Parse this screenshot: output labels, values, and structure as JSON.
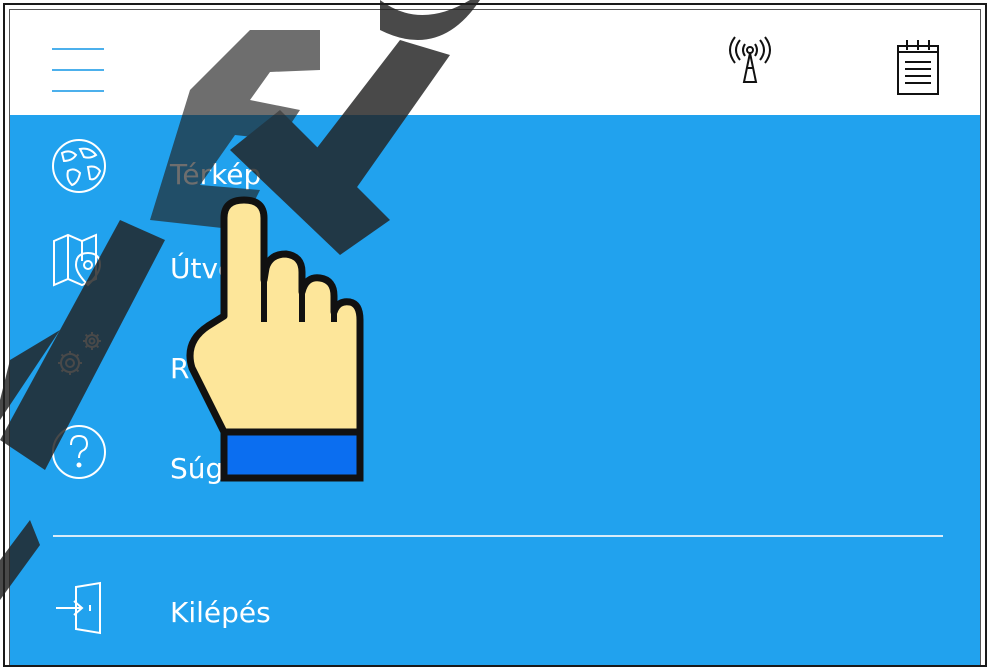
{
  "menu": {
    "items": [
      {
        "label": "Térkép",
        "icon": "globe-icon"
      },
      {
        "label": "Útvonal",
        "icon": "map-pin-icon"
      },
      {
        "label": "R",
        "icon": "gears-icon"
      },
      {
        "label": "Súg",
        "icon": "help-icon"
      }
    ],
    "logout": {
      "label": "Kilépés",
      "icon": "exit-door-icon"
    }
  },
  "header": {
    "icons": [
      "hamburger-menu-icon",
      "antenna-signal-icon",
      "notepad-icon"
    ]
  },
  "watermark": {
    "text": "lexo"
  },
  "colors": {
    "menu_bg": "#21a2ee",
    "hamburger": "#4cb0ec",
    "hand_skin": "#fde69a",
    "hand_cuff": "#0b6ef0"
  }
}
